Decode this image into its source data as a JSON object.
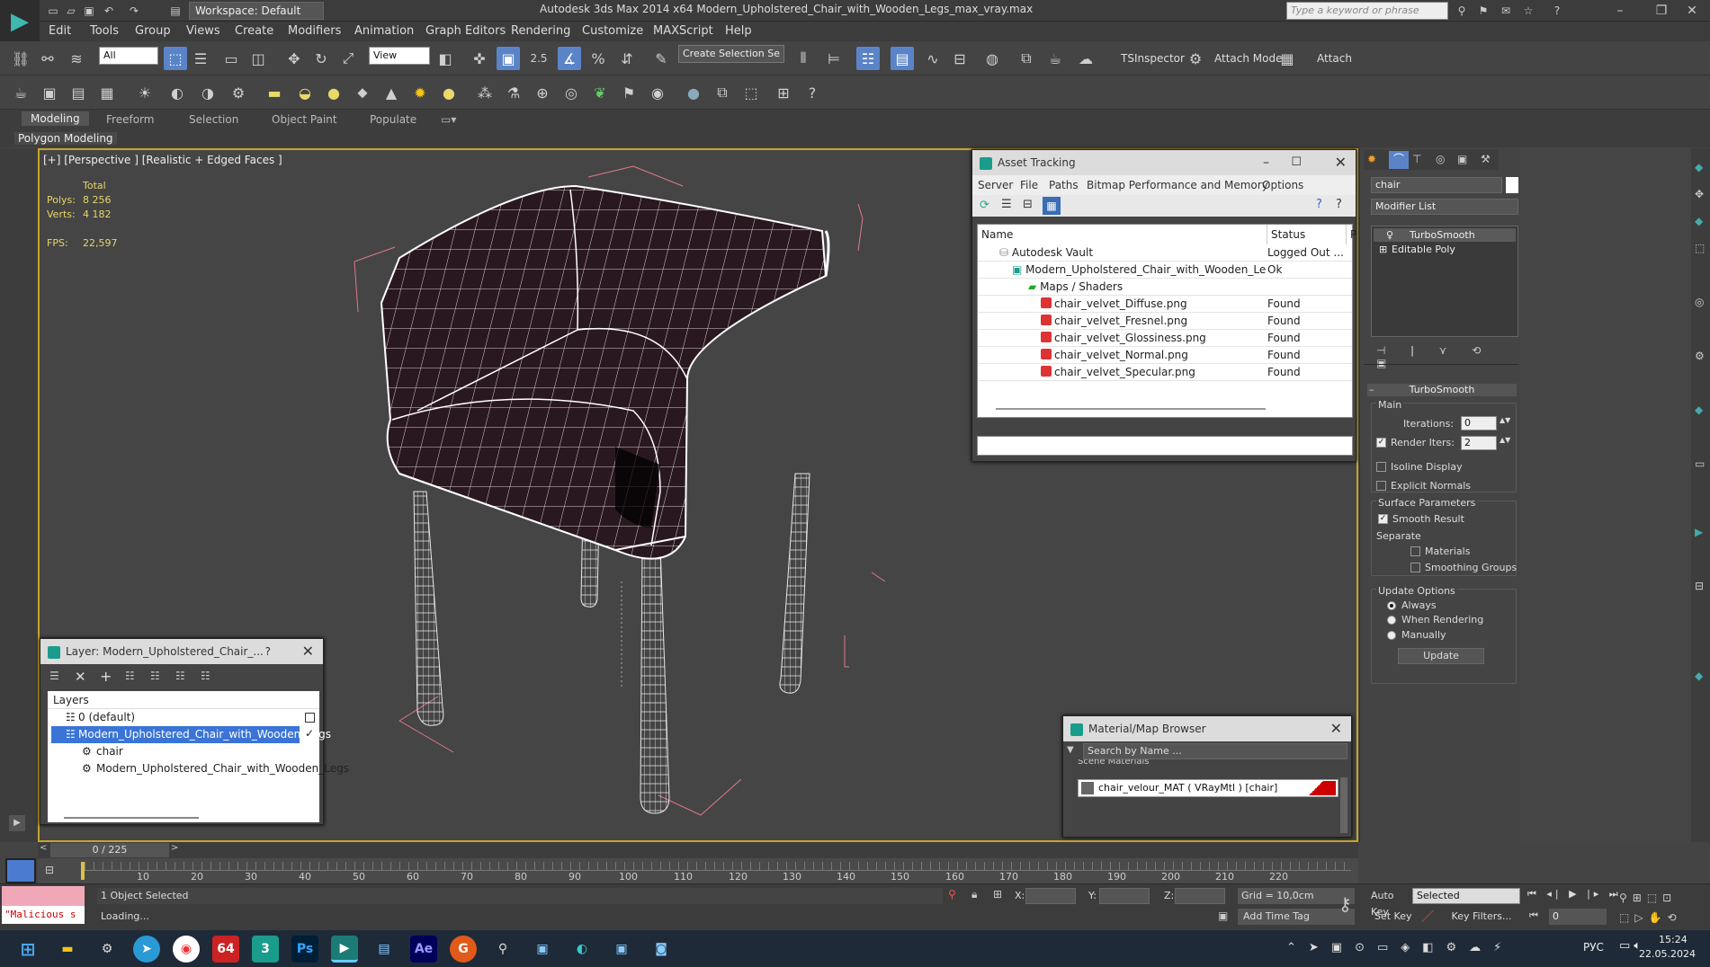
{
  "titlebar": {
    "app_title": "Autodesk 3ds Max  2014 x64     Modern_Upholstered_Chair_with_Wooden_Legs_max_vray.max",
    "workspace": "Workspace: Default",
    "search_placeholder": "Type a keyword or phrase"
  },
  "menu": [
    "Edit",
    "Tools",
    "Group",
    "Views",
    "Create",
    "Modifiers",
    "Animation",
    "Graph Editors",
    "Rendering",
    "Customize",
    "MAXScript",
    "Help"
  ],
  "toolbar": {
    "filter_dropdown": "All",
    "refcoord_dropdown": "View",
    "selection_set": "Create Selection Se",
    "tsinspector": "TSInspector",
    "attach_mode": "Attach Mode",
    "attach": "Attach",
    "snap_label": "2.5"
  },
  "ribbon": {
    "tabs": [
      "Modeling",
      "Freeform",
      "Selection",
      "Object Paint",
      "Populate"
    ],
    "active_tab": "Modeling",
    "panel_label": "Polygon Modeling"
  },
  "viewport": {
    "label": "[+] [Perspective ] [Realistic + Edged Faces ]",
    "stats_header": "Total",
    "polys_label": "Polys:",
    "polys_value": "8 256",
    "verts_label": "Verts:",
    "verts_value": "4 182",
    "fps_label": "FPS:",
    "fps_value": "22,597"
  },
  "asset_tracking": {
    "title": "Asset Tracking",
    "menu": [
      "Server",
      "File",
      "Paths",
      "Bitmap Performance and Memory",
      "Options"
    ],
    "columns": [
      "Name",
      "Status",
      "P"
    ],
    "rows": [
      {
        "name": "Autodesk Vault",
        "status": "Logged Out ..."
      },
      {
        "name": "Modern_Upholstered_Chair_with_Wooden_Legs...",
        "status": "Ok"
      },
      {
        "name": "Maps / Shaders",
        "status": ""
      },
      {
        "name": "chair_velvet_Diffuse.png",
        "status": "Found"
      },
      {
        "name": "chair_velvet_Fresnel.png",
        "status": "Found"
      },
      {
        "name": "chair_velvet_Glossiness.png",
        "status": "Found"
      },
      {
        "name": "chair_velvet_Normal.png",
        "status": "Found"
      },
      {
        "name": "chair_velvet_Specular.png",
        "status": "Found"
      }
    ]
  },
  "layer_window": {
    "title": "Layer: Modern_Upholstered_Chair_...",
    "help": "?",
    "list_header": "Layers",
    "items": [
      {
        "label": "0 (default)"
      },
      {
        "label": "Modern_Upholstered_Chair_with_Wooden_Legs"
      },
      {
        "label": "chair"
      },
      {
        "label": "Modern_Upholstered_Chair_with_Wooden_Legs"
      }
    ]
  },
  "material_browser": {
    "title": "Material/Map Browser",
    "search_placeholder": "Search by Name ...",
    "section": "Scene Materials",
    "item": "chair_velour_MAT  ( VRayMtl )  [chair]"
  },
  "command_panel": {
    "object_name": "chair",
    "modifier_list": "Modifier List",
    "stack": [
      "TurboSmooth",
      "Editable Poly"
    ],
    "rollout_title": "TurboSmooth",
    "main_label": "Main",
    "iterations_label": "Iterations:",
    "iterations_value": "0",
    "render_iters_label": "Render Iters:",
    "render_iters_value": "2",
    "isoline_label": "Isoline Display",
    "explicit_normals_label": "Explicit Normals",
    "surface_params_label": "Surface Parameters",
    "smooth_result_label": "Smooth Result",
    "separate_label": "Separate",
    "materials_label": "Materials",
    "smoothing_groups_label": "Smoothing Groups",
    "update_options_label": "Update Options",
    "always_label": "Always",
    "when_rendering_label": "When Rendering",
    "manually_label": "Manually",
    "update_button": "Update"
  },
  "timeline": {
    "frame_display": "0 / 225",
    "ticks": [
      "10",
      "20",
      "30",
      "40",
      "50",
      "60",
      "70",
      "80",
      "90",
      "100",
      "110",
      "120",
      "130",
      "140",
      "150",
      "160",
      "170",
      "180",
      "190",
      "200",
      "210",
      "220"
    ]
  },
  "status": {
    "script_text": "\"Malicious s",
    "selected_text": "1 Object Selected",
    "loading_text": "Loading...",
    "x_label": "X:",
    "y_label": "Y:",
    "z_label": "Z:",
    "grid": "Grid = 10,0cm",
    "add_time_tag": "Add Time Tag",
    "auto_key": "Auto Key",
    "set_key": "Set Key",
    "selected_dropdown": "Selected",
    "key_filters": "Key Filters...",
    "frame_field": "0"
  },
  "taskbar": {
    "language": "РУС",
    "time": "15:24",
    "date": "22.05.2024",
    "badge_64": "64"
  }
}
